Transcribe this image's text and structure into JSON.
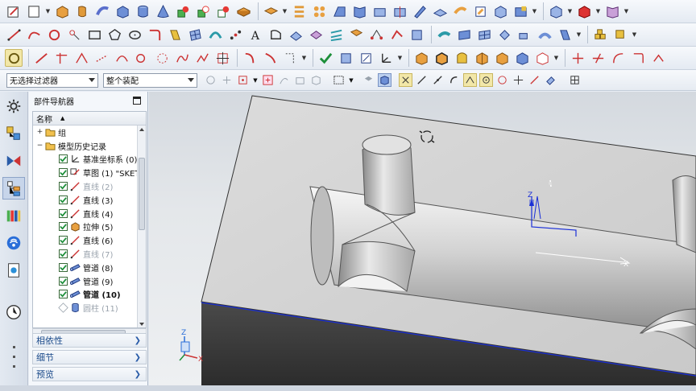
{
  "filter_bar": {
    "type_filter": "无选择过滤器",
    "scope_filter": "整个装配"
  },
  "part_navigator": {
    "title": "部件导航器",
    "column_name": "名称",
    "items": [
      {
        "label": "组",
        "expander": "+",
        "icon": "folder-icon",
        "checked": false,
        "state": "normal"
      },
      {
        "label": "模型历史记录",
        "expander": "−",
        "icon": "folder-icon",
        "checked": false,
        "state": "normal"
      },
      {
        "label": "基准坐标系 (0)",
        "icon": "datum-csys-icon",
        "checked": true,
        "state": "normal"
      },
      {
        "label": "草图 (1) \"SKET",
        "icon": "sketch-icon",
        "checked": true,
        "state": "normal"
      },
      {
        "label": "直线 (2)",
        "icon": "line-icon",
        "checked": true,
        "state": "dim"
      },
      {
        "label": "直线 (3)",
        "icon": "line-icon",
        "checked": true,
        "state": "normal"
      },
      {
        "label": "直线 (4)",
        "icon": "line-icon",
        "checked": true,
        "state": "normal"
      },
      {
        "label": "拉伸 (5)",
        "icon": "extrude-icon",
        "checked": true,
        "state": "normal"
      },
      {
        "label": "直线 (6)",
        "icon": "line-icon",
        "checked": true,
        "state": "normal"
      },
      {
        "label": "直线 (7)",
        "icon": "line-icon",
        "checked": true,
        "state": "dim"
      },
      {
        "label": "管道 (8)",
        "icon": "tube-icon",
        "checked": true,
        "state": "normal"
      },
      {
        "label": "管道 (9)",
        "icon": "tube-icon",
        "checked": true,
        "state": "normal"
      },
      {
        "label": "管道 (10)",
        "icon": "tube-icon",
        "checked": true,
        "state": "bold"
      },
      {
        "label": "圆柱 (11)",
        "icon": "cylinder-icon",
        "checked": false,
        "state": "dim"
      }
    ],
    "sections": [
      {
        "label": "相依性"
      },
      {
        "label": "细节"
      },
      {
        "label": "预览"
      }
    ]
  },
  "viewport": {
    "triad_x": "X",
    "triad_z": "Z",
    "wcs_x": "X",
    "wcs_z": "Z"
  },
  "colors": {
    "accent": "#2a5ca8",
    "part_top": "#d6d6d6",
    "part_side": "#3a3a3a",
    "edge_blue": "#1a2fd8"
  }
}
